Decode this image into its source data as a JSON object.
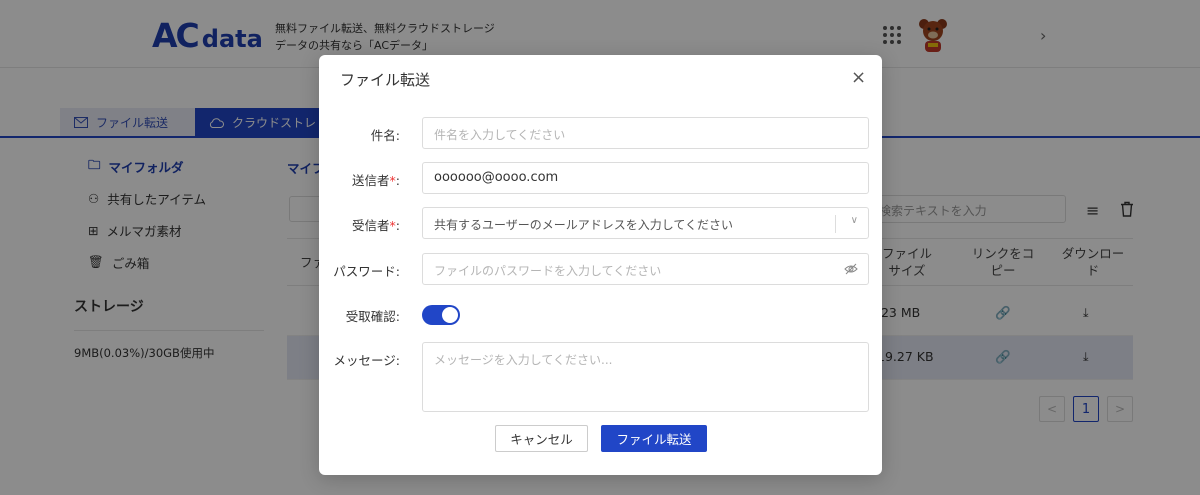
{
  "header": {
    "logo_ac": "AC",
    "logo_data": "data",
    "tagline_line1": "無料ファイル転送、無料クラウドストレージ",
    "tagline_line2": "データの共有なら「ACデータ」"
  },
  "tabs": [
    {
      "label": "ファイル転送"
    },
    {
      "label": "クラウドストレ"
    }
  ],
  "sidebar": {
    "items": [
      {
        "label": "マイフォルダ"
      },
      {
        "label": "共有したアイテム"
      },
      {
        "label": "メルマガ素材"
      },
      {
        "label": "ごみ箱"
      }
    ],
    "storage_heading": "ストレージ",
    "storage_usage": "9MB(0.03%)/30GB使用中"
  },
  "main": {
    "title": "マイフ",
    "search_placeholder": "検索テキストを入力",
    "columns": {
      "file": "ファ",
      "size": "ファイルサイズ",
      "copy_link": "リンクをコピー",
      "download": "ダウンロード"
    },
    "rows": [
      {
        "size": ".23 MB"
      },
      {
        "size": "19.27 KB"
      }
    ],
    "pagination": {
      "prev": "<",
      "current": "1",
      "next": ">"
    }
  },
  "dialog": {
    "title": "ファイル転送",
    "close": "×",
    "subject": {
      "label": "件名:",
      "placeholder": "件名を入力してください"
    },
    "sender": {
      "label": "送信者",
      "required_mark": "*",
      "suffix": ":",
      "value": "oooooo@oooo.com"
    },
    "recipient": {
      "label": "受信者",
      "required_mark": "*",
      "suffix": ":",
      "placeholder": "共有するユーザーのメールアドレスを入力してください"
    },
    "password": {
      "label": "パスワード:",
      "placeholder": "ファイルのパスワードを入力してください"
    },
    "receipt": {
      "label": "受取確認:",
      "enabled": true
    },
    "message": {
      "label": "メッセージ:",
      "placeholder": "メッセージを入力してください..."
    },
    "cancel_label": "キャンセル",
    "submit_label": "ファイル転送"
  },
  "colors": {
    "brand": "#1f3fb0",
    "primary": "#2146c7",
    "required": "#ee3333"
  }
}
